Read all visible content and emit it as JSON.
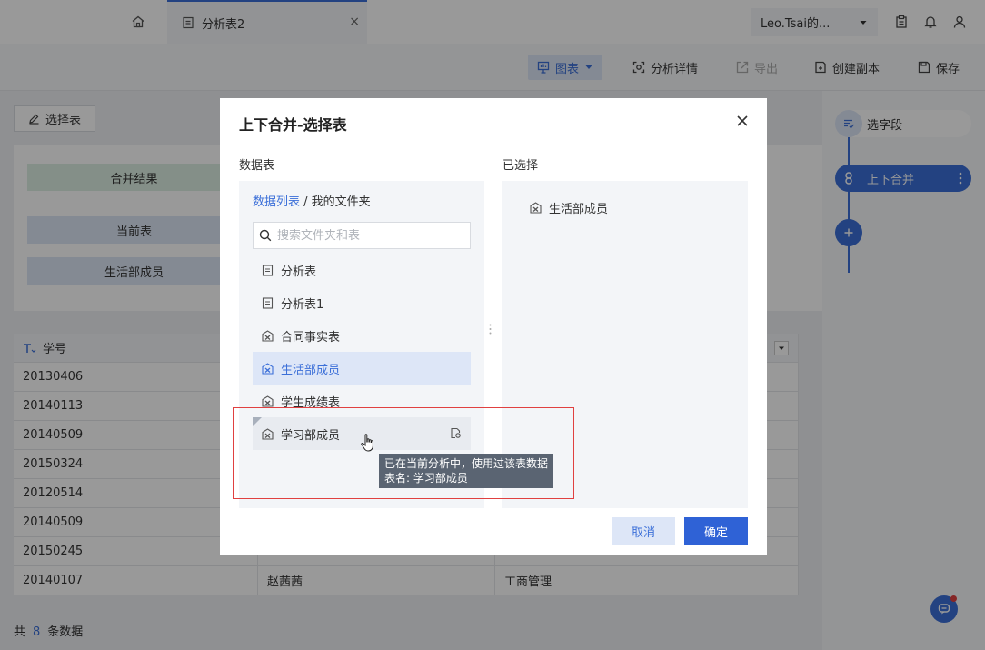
{
  "topbar": {
    "tab_label": "分析表2",
    "tab_close": "×",
    "user_name": "Leo.Tsai的..."
  },
  "toolbar": {
    "chart": "图表",
    "analysis_detail": "分析详情",
    "export": "导出",
    "create_copy": "创建副本",
    "save": "保存"
  },
  "left": {
    "select_table": "选择表",
    "merge_result": "合并结果",
    "current_table": "当前表",
    "table_name": "生活部成员"
  },
  "grid": {
    "header": [
      "学号",
      "",
      ""
    ],
    "rows": [
      [
        "20130406",
        "",
        ""
      ],
      [
        "20140113",
        "",
        ""
      ],
      [
        "20140509",
        "",
        ""
      ],
      [
        "20150324",
        "",
        ""
      ],
      [
        "20120514",
        "",
        ""
      ],
      [
        "20140509",
        "",
        ""
      ],
      [
        "20150245",
        "",
        ""
      ],
      [
        "20140107",
        "赵茜茜",
        "工商管理"
      ]
    ],
    "footer_prefix": "共",
    "footer_count": "8",
    "footer_suffix": "条数据"
  },
  "flow": {
    "select_fields": "选字段",
    "merge_updown": "上下合并"
  },
  "dialog": {
    "title": "上下合并-选择表",
    "left_title": "数据表",
    "right_title": "已选择",
    "breadcrumb_link": "数据列表",
    "breadcrumb_sep": " / ",
    "breadcrumb_current": "我的文件夹",
    "search_placeholder": "搜索文件夹和表",
    "items": [
      "分析表",
      "分析表1",
      "合同事实表",
      "生活部成员",
      "学生成绩表",
      "学习部成员"
    ],
    "selected": [
      "生活部成员"
    ],
    "tooltip_line1": "已在当前分析中，使用过该表数据",
    "tooltip_line2": "表名: 学习部成员",
    "cancel": "取消",
    "ok": "确定"
  },
  "colors": {
    "accent": "#3b6fd8",
    "primary_button": "#2f62d6",
    "highlight": "#e04040"
  }
}
